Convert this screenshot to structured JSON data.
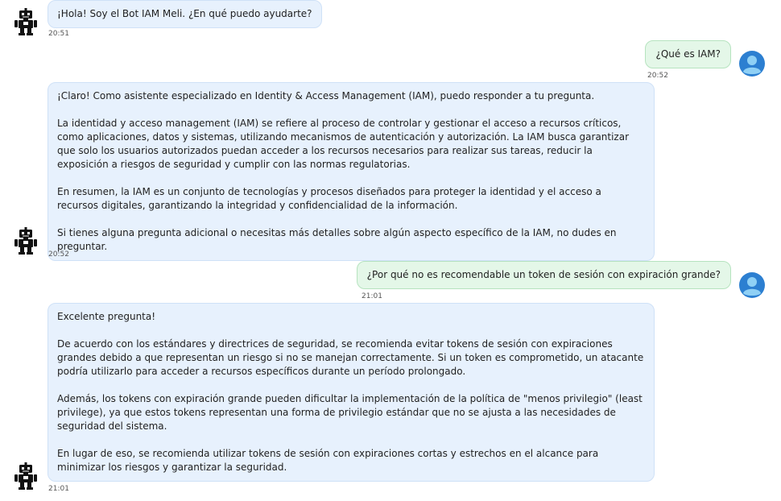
{
  "messages": [
    {
      "sender": "bot",
      "text": "¡Hola! Soy el Bot IAM Meli. ¿En qué puedo ayudarte?",
      "time": "20:51"
    },
    {
      "sender": "user",
      "text": "¿Qué es IAM?",
      "time": "20:52"
    },
    {
      "sender": "bot",
      "text": "¡Claro! Como asistente especializado en Identity & Access Management (IAM), puedo responder a tu pregunta.\n\nLa identidad y acceso management (IAM) se refiere al proceso de controlar y gestionar el acceso a recursos críticos, como aplicaciones, datos y sistemas, utilizando mecanismos de autenticación y autorización. La IAM busca garantizar que solo los usuarios autorizados puedan acceder a los recursos necesarios para realizar sus tareas, reducir la exposición a riesgos de seguridad y cumplir con las normas regulatorias.\n\nEn resumen, la IAM es un conjunto de tecnologías y procesos diseñados para proteger la identidad y el acceso a recursos digitales, garantizando la integridad y confidencialidad de la información.\n\nSi tienes alguna pregunta adicional o necesitas más detalles sobre algún aspecto específico de la IAM, no dudes en preguntar.",
      "time": "20:52"
    },
    {
      "sender": "user",
      "text": "¿Por qué no es recomendable un token de sesión con expiración grande?",
      "time": "21:01"
    },
    {
      "sender": "bot",
      "text": "Excelente pregunta!\n\nDe acuerdo con los estándares y directrices de seguridad, se recomienda evitar tokens de sesión con expiraciones grandes debido a que representan un riesgo si no se manejan correctamente. Si un token es comprometido, un atacante podría utilizarlo para acceder a recursos específicos durante un período prolongado.\n\nAdemás, los tokens con expiración grande pueden dificultar la implementación de la política de \"menos privilegio\" (least privilege), ya que estos tokens representan una forma de privilegio estándar que no se ajusta a las necesidades de seguridad del sistema.\n\nEn lugar de eso, se recomienda utilizar tokens de sesión con expiraciones cortas y estrechos en el alcance para minimizar los riesgos y garantizar la seguridad.",
      "time": "21:01"
    }
  ],
  "icons": {
    "bot_avatar": "robot-icon",
    "user_avatar": "user-icon"
  },
  "colors": {
    "bot_bubble": "#e7f1fd",
    "user_bubble": "#e4f7e8",
    "user_avatar_bg": "#2c7fd1"
  }
}
